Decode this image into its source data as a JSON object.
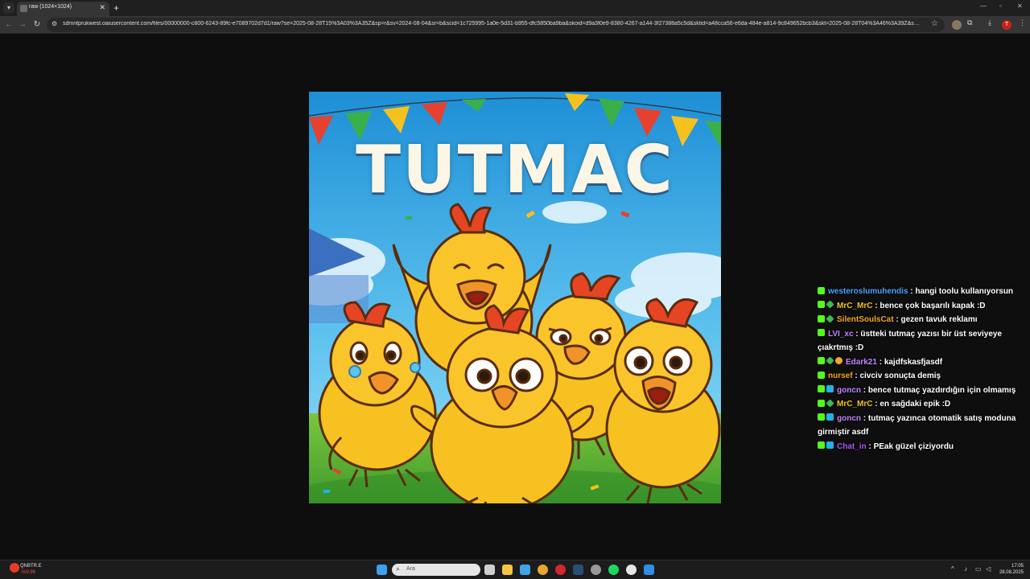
{
  "browser": {
    "tab_title": "raw (1024×1024)",
    "url": "sdmntprukwest.oaiusercontent.com/files/00000000-c800-6243-89fc-e7089702d7d1/raw?se=2025-08-28T15%3A03%3A35Z&sp=r&sv=2024-08-04&sr=b&scid=1c725995-1a0e-5d31-b955-dfc5850ba9ba&skoid=d9a3f0e9-8380-4267-a144-3f27388a5c5d&sktid=a48cca56-e6da-484e-a814-9c849652bcb3&skt=2025-08-28T04%3A46%3A39Z&ske=..."
  },
  "artwork": {
    "title": "TUTMAC"
  },
  "chat": [
    {
      "user": "westeroslumuhendis",
      "color": "#4aa3ff",
      "badges": [
        "kick"
      ],
      "text": "hangi toolu kullanıyorsun"
    },
    {
      "user": "MrC_MrC",
      "color": "#f0c420",
      "badges": [
        "kick",
        "sub"
      ],
      "text": "bence çok başarılı kapak :D"
    },
    {
      "user": "SilentSoulsCat",
      "color": "#f5a623",
      "badges": [
        "kick",
        "sub"
      ],
      "text": "gezen tavuk reklamı"
    },
    {
      "user": "LVI_xc",
      "color": "#c084fc",
      "badges": [
        "kick"
      ],
      "text": "üstteki tutmaç yazısı bir üst seviyeye çıakrtmış :D"
    },
    {
      "user": "Edark21",
      "color": "#c084fc",
      "badges": [
        "kick",
        "sub",
        "coin"
      ],
      "text": "kajdfskasfjasdf"
    },
    {
      "user": "nursef",
      "color": "#f5a623",
      "badges": [
        "kick"
      ],
      "text": "civciv sonuçta demiş"
    },
    {
      "user": "goncn",
      "color": "#c084fc",
      "badges": [
        "kick",
        "gift"
      ],
      "text": "bence tutmaç yazdırdığın için olmamış"
    },
    {
      "user": "MrC_MrC",
      "color": "#f0c420",
      "badges": [
        "kick",
        "sub"
      ],
      "text": "en sağdaki epik :D"
    },
    {
      "user": "goncn",
      "color": "#c084fc",
      "badges": [
        "kick",
        "gift"
      ],
      "text": "tutmaç yazınca otomatik satış moduna girmiştir asdf"
    },
    {
      "user": "Chat_in",
      "color": "#a855f7",
      "badges": [
        "kick",
        "gift"
      ],
      "text": "PEak güzel çiziyordu"
    }
  ],
  "taskbar": {
    "weather_name": "QNBTR.E",
    "weather_value": "-%9,96",
    "search_placeholder": "Ara",
    "time": "17:05",
    "date": "28.08.2025"
  }
}
